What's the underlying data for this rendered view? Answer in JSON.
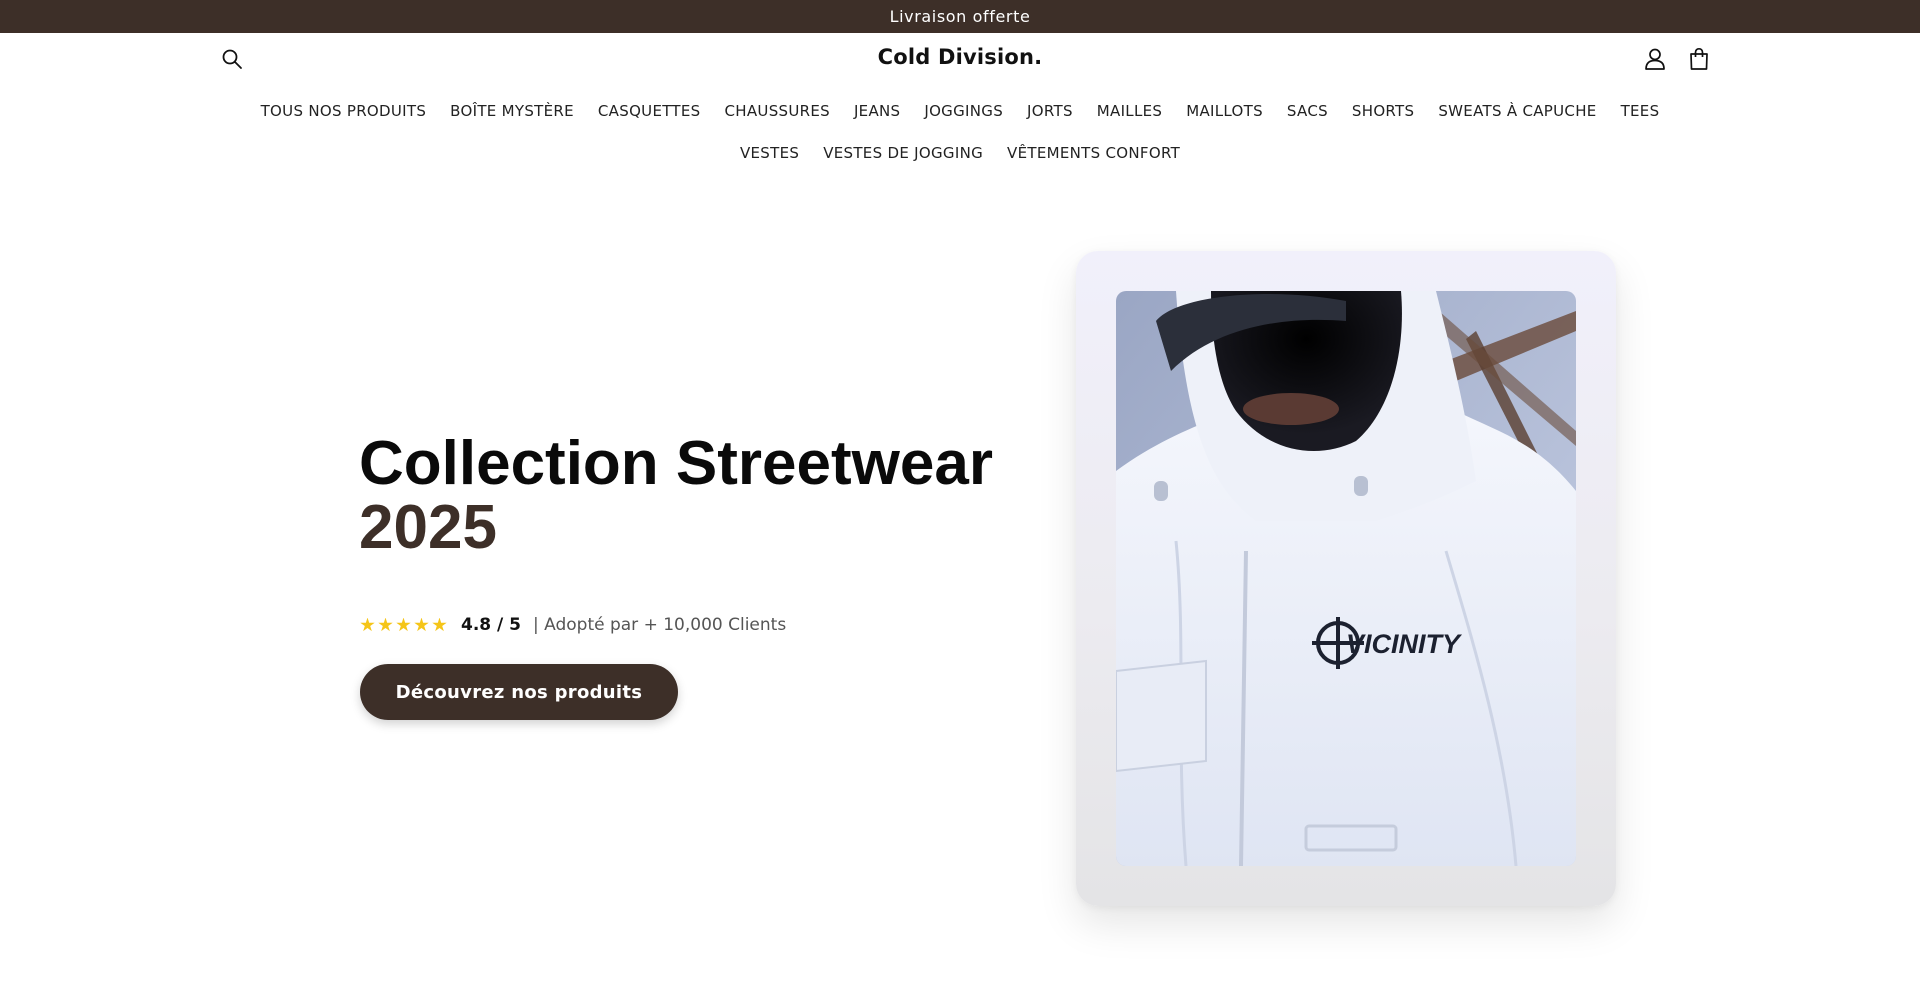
{
  "announcement": {
    "text": "Livraison offerte"
  },
  "header": {
    "brand": "Cold Division.",
    "icons": {
      "search": "search-icon",
      "account": "account-icon",
      "cart": "shopping-bag-icon"
    }
  },
  "nav": {
    "row1": [
      "TOUS NOS PRODUITS",
      "BOÎTE MYSTÈRE",
      "CASQUETTES",
      "CHAUSSURES",
      "JEANS",
      "JOGGINGS",
      "JORTS",
      "MAILLES",
      "MAILLOTS",
      "SACS",
      "SHORTS",
      "SWEATS À CAPUCHE",
      "TEES"
    ],
    "row2": [
      "VESTES",
      "VESTES DE JOGGING",
      "VÊTEMENTS CONFORT"
    ]
  },
  "hero": {
    "title_line1": "Collection Streetwear",
    "title_line2": "2025",
    "rating": {
      "stars": 5,
      "score": "4.8 / 5",
      "adopted": "| Adopté par + 10,000 Clients"
    },
    "cta_label": "Découvrez nos produits",
    "image_logo": "VICINITY"
  },
  "colors": {
    "brand_brown": "#3d2f28",
    "star_yellow": "#f5c518",
    "text_dark": "#0a0a0a"
  }
}
